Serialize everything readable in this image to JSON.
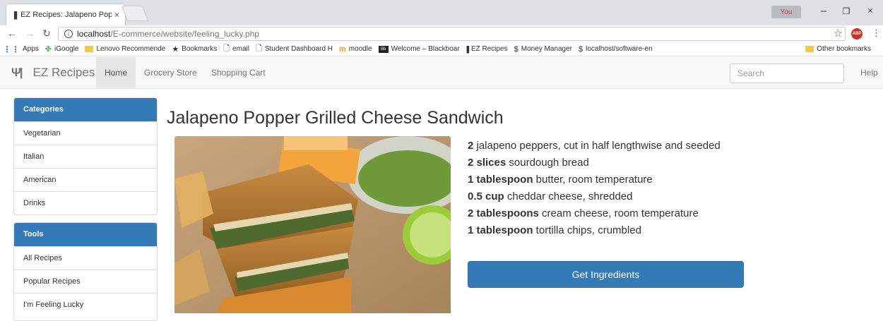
{
  "browser": {
    "tab_title": "EZ Recipes: Jalapeno Pop",
    "profile_label": "You",
    "url_host": "localhost",
    "url_path": "/E-commerce/website/feeling_lucky.php"
  },
  "bookmarks": {
    "items": [
      "Apps",
      "iGoogle",
      "Lenovo Recommende",
      "Bookmarks",
      "email",
      "Student Dashboard H",
      "moodle",
      "Welcome – Blackboar",
      "EZ Recipes",
      "Money Manager",
      "localhost/software-en"
    ],
    "other": "Other bookmarks"
  },
  "site": {
    "brand": "EZ Recipes",
    "nav": [
      "Home",
      "Grocery Store",
      "Shopping Cart"
    ],
    "search_placeholder": "Search",
    "help": "Help"
  },
  "sidebar": {
    "categories_title": "Categories",
    "categories": [
      "Vegetarian",
      "Italian",
      "American",
      "Drinks"
    ],
    "tools_title": "Tools",
    "tools": [
      "All Recipes",
      "Popular Recipes",
      "I'm Feeling Lucky"
    ]
  },
  "recipe": {
    "title": "Jalapeno Popper Grilled Cheese Sandwich",
    "ingredients": [
      {
        "qty": "2",
        "text": " jalapeno peppers, cut in half lengthwise and seeded"
      },
      {
        "qty": "2 slices",
        "text": " sourdough bread"
      },
      {
        "qty": "1 tablespoon",
        "text": " butter, room temperature"
      },
      {
        "qty": "0.5 cup",
        "text": " cheddar cheese, shredded"
      },
      {
        "qty": "2 tablespoons",
        "text": " cream cheese, room temperature"
      },
      {
        "qty": "1 tablespoon",
        "text": " tortilla chips, crumbled"
      }
    ],
    "button": "Get Ingredients"
  }
}
